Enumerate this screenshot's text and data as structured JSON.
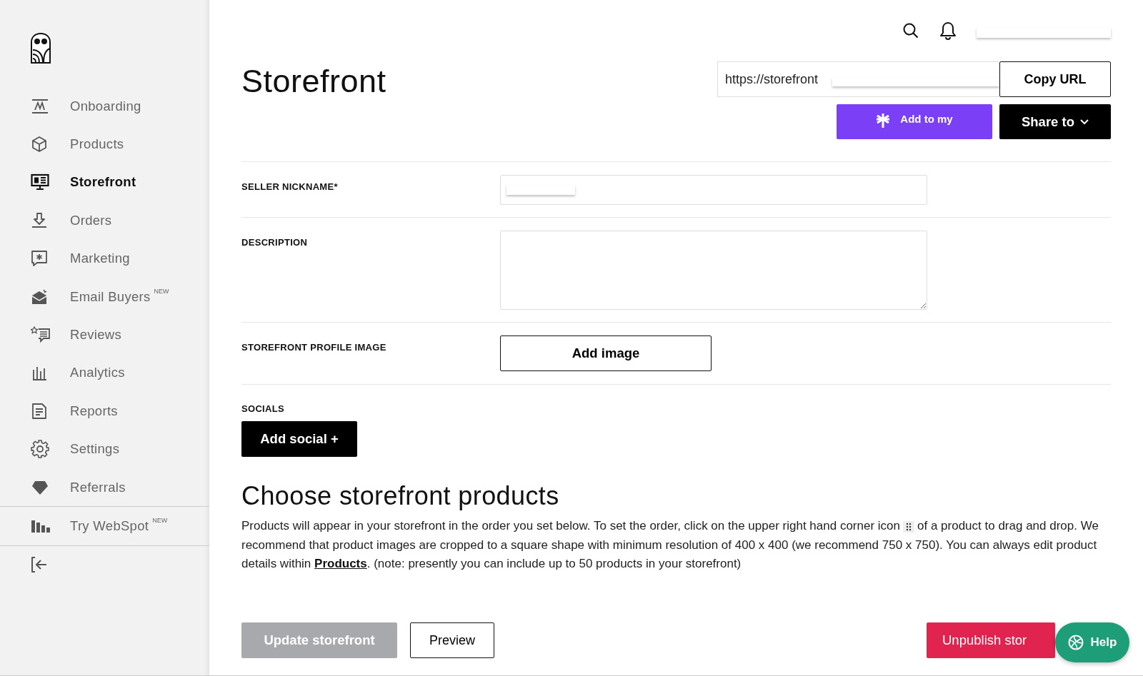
{
  "sidebar": {
    "items": [
      {
        "label": "Onboarding",
        "selected": false
      },
      {
        "label": "Products",
        "selected": false
      },
      {
        "label": "Storefront",
        "selected": true
      },
      {
        "label": "Orders",
        "selected": false
      },
      {
        "label": "Marketing",
        "selected": false
      },
      {
        "label": "Email Buyers",
        "selected": false,
        "badge": "NEW"
      },
      {
        "label": "Reviews",
        "selected": false
      },
      {
        "label": "Analytics",
        "selected": false
      },
      {
        "label": "Reports",
        "selected": false
      },
      {
        "label": "Settings",
        "selected": false
      },
      {
        "label": "Referrals",
        "selected": false
      }
    ],
    "extra": {
      "label": "Try WebSpot",
      "badge": "NEW"
    }
  },
  "page": {
    "title": "Storefront"
  },
  "url_field": {
    "value": "https://storefront"
  },
  "buttons": {
    "copy": "Copy URL",
    "linktree": "Add to my",
    "share": "Share to",
    "add_image": "Add image",
    "add_social": "Add social +"
  },
  "form": {
    "nickname_label": "SELLER NICKNAME*",
    "description_label": "DESCRIPTION",
    "image_label": "STOREFRONT PROFILE IMAGE",
    "socials_label": "SOCIALS"
  },
  "products": {
    "heading": "Choose storefront products",
    "before": "Products will appear in your storefront in the order you set below. To set the order, click on the upper right hand corner icon",
    "after": "of a product to drag and drop. We recommend that product images are cropped to a square shape with minimum resolution of 400 x 400 (we recommend 750 x 750). You can always edit product details within",
    "link": "Products",
    "end": ". (note: presently you can include up to 50 products in your storefront)"
  },
  "footer": {
    "update": "Update storefront",
    "update_disabled": true,
    "preview": "Preview",
    "unpublish": "Unpublish stor",
    "help": "Help"
  }
}
